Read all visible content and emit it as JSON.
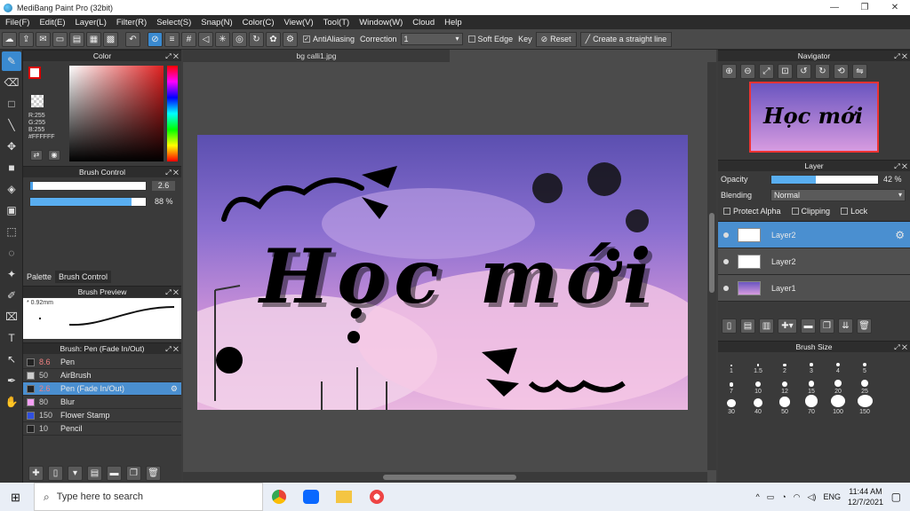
{
  "window": {
    "title": "MediBang Paint Pro (32bit)",
    "minimize": "—",
    "maximize": "❐",
    "close": "✕"
  },
  "menu": [
    "File(F)",
    "Edit(E)",
    "Layer(L)",
    "Filter(R)",
    "Select(S)",
    "Snap(N)",
    "Color(C)",
    "View(V)",
    "Tool(T)",
    "Window(W)",
    "Cloud",
    "Help"
  ],
  "toolbar": {
    "antialiasing": "AntiAliasing",
    "correction_label": "Correction",
    "correction_value": "1",
    "soft_edge": "Soft Edge",
    "key": "Key",
    "reset": "Reset",
    "straight_line": "Create a straight line"
  },
  "color_panel": {
    "title": "Color",
    "r": "R:255",
    "g": "G:255",
    "b": "B:255",
    "hex": "#FFFFFF"
  },
  "brush_control": {
    "title": "Brush Control",
    "size_value": "2.6",
    "opacity_value": "88",
    "opacity_unit": "%",
    "opacity_fraction": 0.88,
    "tabs": [
      "Palette",
      "Brush Control"
    ]
  },
  "brush_preview": {
    "title": "Brush Preview",
    "size": "0.92mm"
  },
  "brush_list": {
    "title": "Brush: Pen (Fade In/Out)",
    "items": [
      {
        "size": "8.6",
        "name": "Pen"
      },
      {
        "size": "50",
        "name": "AirBrush"
      },
      {
        "size": "2.6",
        "name": "Pen (Fade In/Out)"
      },
      {
        "size": "80",
        "name": "Blur"
      },
      {
        "size": "150",
        "name": "Flower Stamp"
      },
      {
        "size": "10",
        "name": "Pencil"
      }
    ]
  },
  "document": {
    "tab": "bg calli1.jpg",
    "artwork_text": "Học mới"
  },
  "navigator": {
    "title": "Navigator"
  },
  "layer_panel": {
    "title": "Layer",
    "opacity_label": "Opacity",
    "opacity_value": "42",
    "opacity_unit": "%",
    "opacity_fraction": 0.42,
    "blending_label": "Blending",
    "blending_value": "Normal",
    "protect_alpha": "Protect Alpha",
    "clipping": "Clipping",
    "lock": "Lock",
    "layers": [
      "Layer2",
      "Layer2",
      "Layer1"
    ]
  },
  "brush_size": {
    "title": "Brush Size",
    "sizes": [
      "1",
      "1.5",
      "2",
      "3",
      "4",
      "5",
      "7",
      "10",
      "12",
      "15",
      "20",
      "25",
      "30",
      "40",
      "50",
      "70",
      "100",
      "150"
    ]
  },
  "taskbar": {
    "search_placeholder": "Type here to search",
    "language": "ENG",
    "time": "11:44 AM",
    "date": "12/7/2021"
  }
}
